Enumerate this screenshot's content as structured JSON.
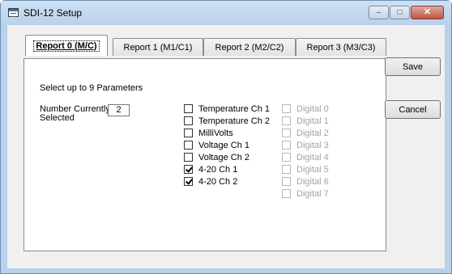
{
  "window": {
    "title": "SDI-12 Setup",
    "controls": {
      "minimize": "–",
      "maximize": "□",
      "close": "✕"
    }
  },
  "tabs": [
    {
      "label": "Report 0 (M/C)",
      "active": true
    },
    {
      "label": "Report 1 (M1/C1)",
      "active": false
    },
    {
      "label": "Report 2 (M2/C2)",
      "active": false
    },
    {
      "label": "Report 3 (M3/C3)",
      "active": false
    }
  ],
  "panel": {
    "instruction": "Select up to 9 Parameters",
    "count_label_line1": "Number Currently",
    "count_label_line2": "Selected",
    "count_value": "2"
  },
  "parameters": [
    {
      "label": "Temperature Ch 1",
      "checked": false
    },
    {
      "label": "Temperature Ch 2",
      "checked": false
    },
    {
      "label": "MilliVolts",
      "checked": false
    },
    {
      "label": "Voltage Ch 1",
      "checked": false
    },
    {
      "label": "Voltage Ch 2",
      "checked": false
    },
    {
      "label": "4-20 Ch 1",
      "checked": true
    },
    {
      "label": "4-20 Ch 2",
      "checked": true
    }
  ],
  "digital": [
    {
      "label": "Digital 0",
      "enabled": false
    },
    {
      "label": "Digital 1",
      "enabled": false
    },
    {
      "label": "Digital 2",
      "enabled": false
    },
    {
      "label": "Digital 3",
      "enabled": false
    },
    {
      "label": "Digital 4",
      "enabled": false
    },
    {
      "label": "Digital 5",
      "enabled": false
    },
    {
      "label": "Digital 6",
      "enabled": false
    },
    {
      "label": "Digital 7",
      "enabled": false
    }
  ],
  "buttons": {
    "save": "Save",
    "cancel": "Cancel"
  }
}
